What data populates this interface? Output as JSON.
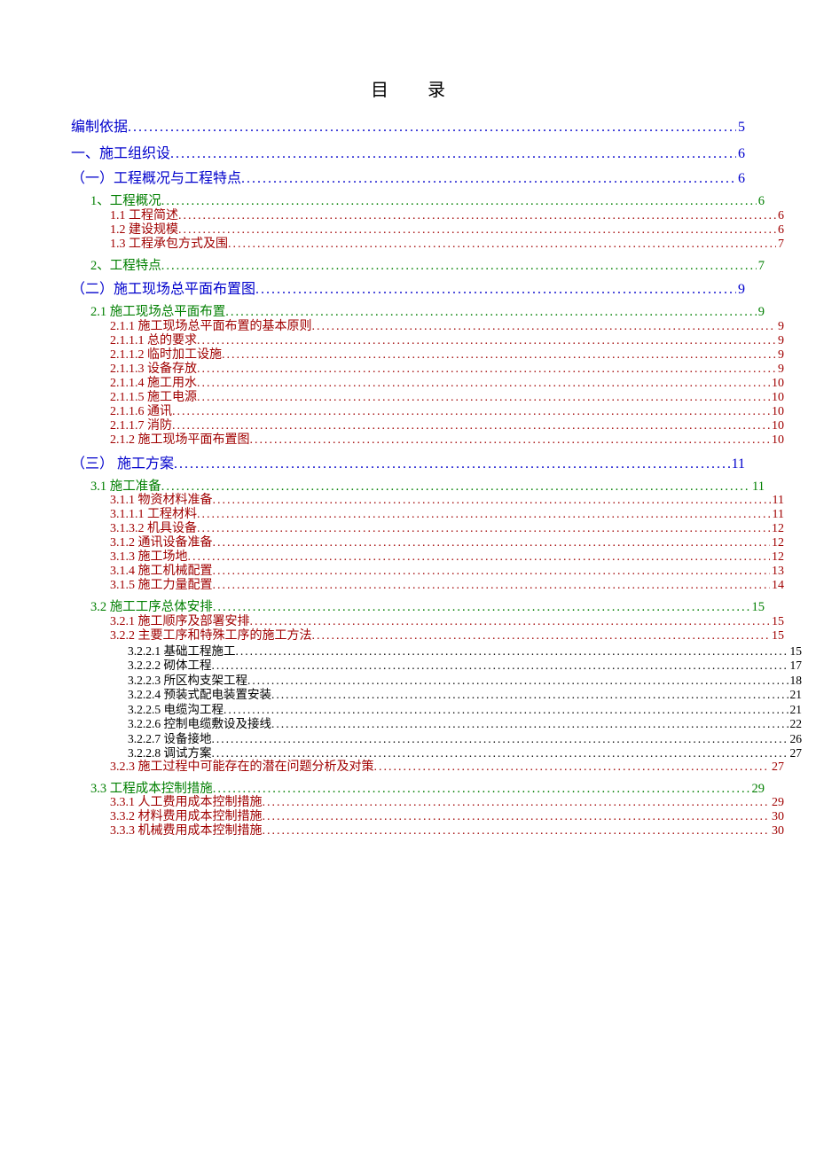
{
  "title_left": "目",
  "title_right": "录",
  "leader_fill": "..........................................................................................................................................................................................",
  "entries": [
    {
      "level": "h1",
      "label": "编制依据",
      "page": "5"
    },
    {
      "level": "h1",
      "label": "一、施工组织设",
      "page": "6"
    },
    {
      "level": "h2",
      "label": "（一）工程概况与工程特点",
      "page": "6"
    },
    {
      "level": "h3",
      "label": "1、工程概况",
      "page": "6"
    },
    {
      "level": "h4",
      "label": "1.1 工程简述",
      "page": "6"
    },
    {
      "level": "h4",
      "label": "1.2 建设规模",
      "page": "6"
    },
    {
      "level": "h4",
      "label": "1.3 工程承包方式及围",
      "page": "7"
    },
    {
      "level": "h3",
      "label": "2、工程特点",
      "page": "7"
    },
    {
      "level": "h2",
      "label": "（二）施工现场总平面布置图",
      "page": "9"
    },
    {
      "level": "h3",
      "label": "2.1 施工现场总平面布置",
      "page": "9"
    },
    {
      "level": "h4",
      "label": "2.1.1 施工现场总平面布置的基本原则",
      "page": "9"
    },
    {
      "level": "h4",
      "label": "2.1.1.1 总的要求",
      "page": "9"
    },
    {
      "level": "h4",
      "label": "2.1.1.2 临时加工设施",
      "page": "9"
    },
    {
      "level": "h4",
      "label": "2.1.1.3 设备存放",
      "page": "9"
    },
    {
      "level": "h4",
      "label": "2.1.1.4 施工用水",
      "page": "10"
    },
    {
      "level": "h4",
      "label": "2.1.1.5 施工电源",
      "page": "10"
    },
    {
      "level": "h4",
      "label": "2.1.1.6 通讯",
      "page": "10"
    },
    {
      "level": "h4",
      "label": "2.1.1.7 消防",
      "page": "10"
    },
    {
      "level": "h4",
      "label": "2.1.2 施工现场平面布置图",
      "page": "10"
    },
    {
      "level": "h2",
      "label": "（三） 施工方案",
      "page": "11"
    },
    {
      "level": "h3",
      "label": "3.1 施工准备",
      "page": "11"
    },
    {
      "level": "h4",
      "label": "3.1.1 物资材料准备",
      "page": "11"
    },
    {
      "level": "h4",
      "label": "3.1.1.1 工程材料",
      "page": "11"
    },
    {
      "level": "h4",
      "label": "3.1.3.2 机具设备",
      "page": "12"
    },
    {
      "level": "h4",
      "label": "3.1.2 通讯设备准备",
      "page": "12"
    },
    {
      "level": "h4",
      "label": "3.1.3 施工场地",
      "page": "12"
    },
    {
      "level": "h4",
      "label": "3.1.4 施工机械配置",
      "page": "13"
    },
    {
      "level": "h4",
      "label": "3.1.5 施工力量配置",
      "page": "14"
    },
    {
      "level": "h3",
      "label": "3.2 施工工序总体安排",
      "page": "15"
    },
    {
      "level": "h4",
      "label": "3.2.1 施工顺序及部署安排",
      "page": "15"
    },
    {
      "level": "h4",
      "label": "3.2.2 主要工序和特殊工序的施工方法",
      "page": "15"
    },
    {
      "level": "h5",
      "label": "3.2.2.1 基础工程施工",
      "page": "15"
    },
    {
      "level": "h5",
      "label": "3.2.2.2 砌体工程",
      "page": "17"
    },
    {
      "level": "h5",
      "label": "3.2.2.3 所区构支架工程",
      "page": "18"
    },
    {
      "level": "h5",
      "label": "3.2.2.4 预装式配电装置安装",
      "page": "21"
    },
    {
      "level": "h5",
      "label": "3.2.2.5 电缆沟工程",
      "page": "21"
    },
    {
      "level": "h5",
      "label": "3.2.2.6 控制电缆敷设及接线",
      "page": "22"
    },
    {
      "level": "h5",
      "label": "3.2.2.7 设备接地",
      "page": "26"
    },
    {
      "level": "h5",
      "label": "3.2.2.8 调试方案",
      "page": "27"
    },
    {
      "level": "h4",
      "label": "3.2.3 施工过程中可能存在的潜在问题分析及对策",
      "page": "27"
    },
    {
      "level": "h3",
      "label": "3.3 工程成本控制措施",
      "page": "29"
    },
    {
      "level": "h4",
      "label": "3.3.1 人工费用成本控制措施",
      "page": "29"
    },
    {
      "level": "h4",
      "label": "3.3.2 材料费用成本控制措施",
      "page": "30"
    },
    {
      "level": "h4",
      "label": "3.3.3 机械费用成本控制措施",
      "page": "30"
    }
  ]
}
